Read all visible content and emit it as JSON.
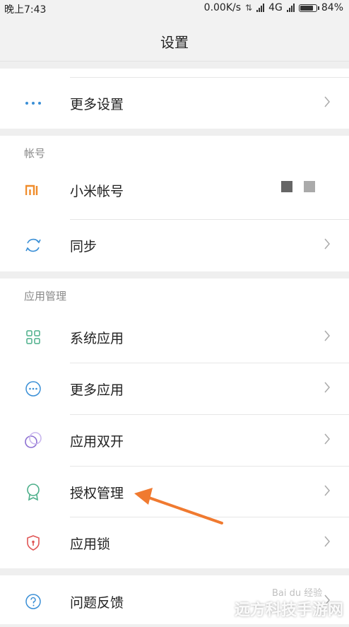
{
  "status": {
    "time": "晚上7:43",
    "speed": "0.00K/s",
    "network": "4G",
    "battery": "84%",
    "battery_level": 0.84
  },
  "header": {
    "title": "设置"
  },
  "sections": {
    "top": {
      "items": [
        {
          "label": "更多设置",
          "icon": "more-dots-icon",
          "has_chevron": true
        }
      ]
    },
    "account": {
      "title": "帐号",
      "items": [
        {
          "label": "小米帐号",
          "icon": "mi-logo-icon",
          "has_chevron": false
        },
        {
          "label": "同步",
          "icon": "sync-icon",
          "has_chevron": true
        }
      ]
    },
    "apps": {
      "title": "应用管理",
      "items": [
        {
          "label": "系统应用",
          "icon": "grid-icon",
          "has_chevron": true
        },
        {
          "label": "更多应用",
          "icon": "more-circle-icon",
          "has_chevron": true
        },
        {
          "label": "应用双开",
          "icon": "dual-app-icon",
          "has_chevron": true
        },
        {
          "label": "授权管理",
          "icon": "badge-icon",
          "has_chevron": true
        },
        {
          "label": "应用锁",
          "icon": "shield-lock-icon",
          "has_chevron": true
        }
      ]
    },
    "feedback": {
      "items": [
        {
          "label": "问题反馈",
          "icon": "help-icon",
          "has_chevron": true
        }
      ]
    }
  },
  "watermark": {
    "text": "远方科技手游网",
    "baidu": "Bai du 经验"
  },
  "colors": {
    "accent_blue": "#3a8fd6",
    "mi_orange": "#f08c2a",
    "arrow": "#f07a30",
    "green": "#4caf8a",
    "purple": "#8c6fd1",
    "red": "#e05555"
  }
}
